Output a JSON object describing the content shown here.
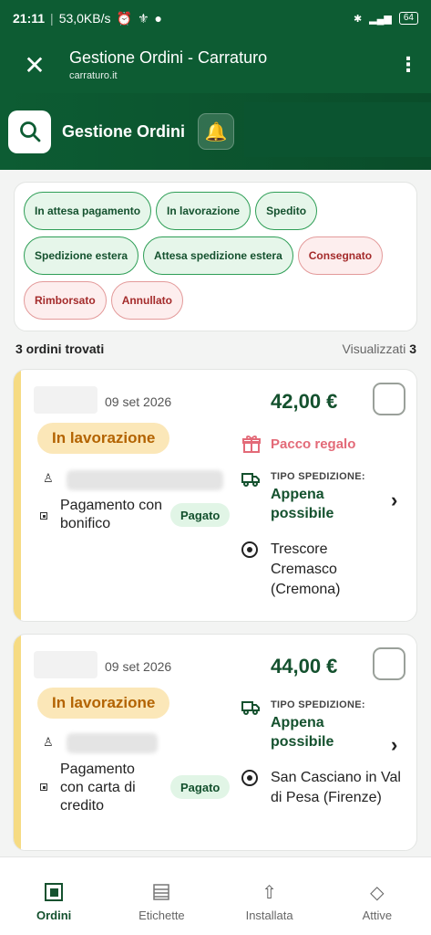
{
  "status_bar": {
    "time": "21:11",
    "network_speed": "53,0KB/s",
    "battery": "64"
  },
  "app_bar": {
    "title": "Gestione Ordini - Carraturo",
    "subtitle": "carraturo.it"
  },
  "header": {
    "title": "Gestione Ordini",
    "bell_icon": "🔔"
  },
  "filters": [
    {
      "label": "In attesa pagamento",
      "tone": "green"
    },
    {
      "label": "In lavorazione",
      "tone": "green"
    },
    {
      "label": "Spedito",
      "tone": "green"
    },
    {
      "label": "Spedizione estera",
      "tone": "green"
    },
    {
      "label": "Attesa spedizione estera",
      "tone": "green"
    },
    {
      "label": "Consegnato",
      "tone": "red"
    },
    {
      "label": "Rimborsato",
      "tone": "red"
    },
    {
      "label": "Annullato",
      "tone": "red"
    }
  ],
  "summary": {
    "found_text": "3 ordini trovati",
    "shown_label": "Visualizzati",
    "shown_count": "3"
  },
  "orders": [
    {
      "date": "09 set 2026",
      "price": "42,00 €",
      "status": "In lavorazione",
      "gift_label": "Pacco regalo",
      "shipping_label": "TIPO SPEDIZIONE:",
      "shipping_value": "Appena possibile",
      "payment": "Pagamento con bonifico",
      "paid_badge": "Pagato",
      "location": "Trescore Cremasco (Cremona)"
    },
    {
      "date": "09 set 2026",
      "price": "44,00 €",
      "status": "In lavorazione",
      "shipping_label": "TIPO SPEDIZIONE:",
      "shipping_value": "Appena possibile",
      "payment": "Pagamento con carta di credito",
      "paid_badge": "Pagato",
      "location": "San Casciano in Val di Pesa (Firenze)"
    }
  ],
  "bottom_nav": [
    {
      "label": "Ordini",
      "icon": "box-icon",
      "active": true
    },
    {
      "label": "Etichette",
      "icon": "list-icon",
      "active": false
    },
    {
      "label": "Installata",
      "icon": "upload-arrow-icon",
      "active": false
    },
    {
      "label": "Attive",
      "icon": "diamond-icon",
      "active": false
    }
  ],
  "colors": {
    "brand_green": "#0d5c33",
    "price_green": "#14512e",
    "status_orange": "#b36300",
    "status_bg": "#fbe7b8",
    "gift_pink": "#e36a78",
    "stripe_yellow": "#f6db83"
  }
}
